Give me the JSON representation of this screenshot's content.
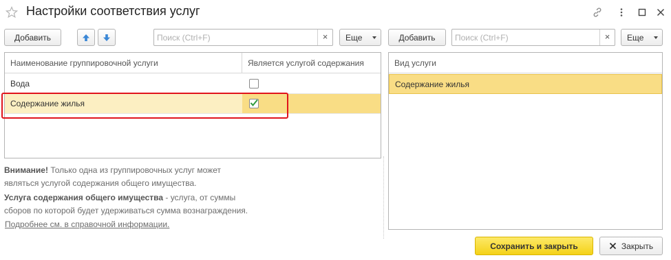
{
  "window": {
    "title": "Настройки соответствия услуг"
  },
  "left_toolbar": {
    "add_label": "Добавить",
    "search_placeholder": "Поиск (Ctrl+F)",
    "clear_symbol": "×",
    "more_label": "Еще"
  },
  "right_toolbar": {
    "add_label": "Добавить",
    "search_placeholder": "Поиск (Ctrl+F)",
    "clear_symbol": "×",
    "more_label": "Еще"
  },
  "left_table": {
    "columns": [
      "Наименование группировочной услуги",
      "Является услугой содержания"
    ],
    "rows": [
      {
        "name": "Вода",
        "is_maintenance": false,
        "selected": false
      },
      {
        "name": "Содержание жилья",
        "is_maintenance": true,
        "selected": true
      }
    ]
  },
  "right_table": {
    "columns": [
      "Вид услуги"
    ],
    "rows": [
      {
        "name": "Содержание жилья",
        "selected": true
      }
    ]
  },
  "info": {
    "warning_bold": "Внимание!",
    "warning_text": " Только одна из группировочных услуг может",
    "warning_text2": "являться услугой содержания общего имущества.",
    "def_bold": "Услуга содержания общего имущества",
    "def_text": " - услуга, от суммы",
    "def_text2": "сборов по которой будет удерживаться сумма вознаграждения.",
    "link": "Подробнее см. в справочной информации."
  },
  "footer": {
    "save_label": "Сохранить и закрыть",
    "close_label": "Закрыть"
  },
  "colors": {
    "selected_row": "#f9dd85",
    "highlight_frame": "#e0131b",
    "primary_button": "#f4d218",
    "arrow_blue": "#3a87d6",
    "check_green": "#2f9a3e"
  }
}
